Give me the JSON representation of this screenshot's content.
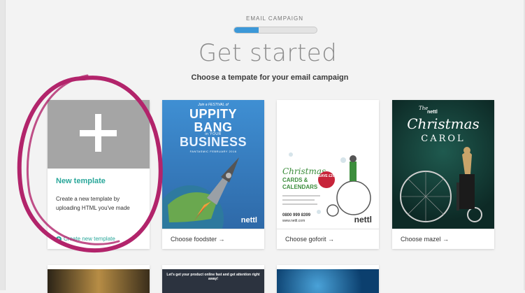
{
  "header": {
    "step_label": "EMAIL CAMPAIGN",
    "progress_fraction": 0.3,
    "title": "Get started",
    "subtitle": "Choose a tempate for your email campaign"
  },
  "new_template": {
    "title": "New template",
    "description": "Create a new template by uploading HTML you've made",
    "link": "Create new template"
  },
  "templates": [
    {
      "footer": "Choose foodster →",
      "poster": {
        "tagline": "Join a FESTIVAL of",
        "line1": "UPPITY",
        "line2": "BANG",
        "line3": "in YOUR",
        "line4": "BUSINESS",
        "date": "FANTASMIC FEBRUARY 2016",
        "logo": "nettl"
      }
    },
    {
      "footer": "Choose goforit →",
      "poster": {
        "headline": "Christmas",
        "line2": "CARDS &",
        "line3": "CALENDARS",
        "badge": "SAVE £20",
        "phone": "0800 999 8399",
        "url": "www.nettl.com",
        "logo": "nettl"
      }
    },
    {
      "footer": "Choose mazel →",
      "poster": {
        "the": "The",
        "brand": "nettl",
        "headline": "Christmas",
        "line2": "CAROL"
      }
    }
  ],
  "row2": {
    "second_text": "Let's get your product online fast and get attention right away!"
  },
  "colors": {
    "accent": "#2aa79a",
    "progress": "#3c98d8",
    "annotation": "#b2246b"
  }
}
